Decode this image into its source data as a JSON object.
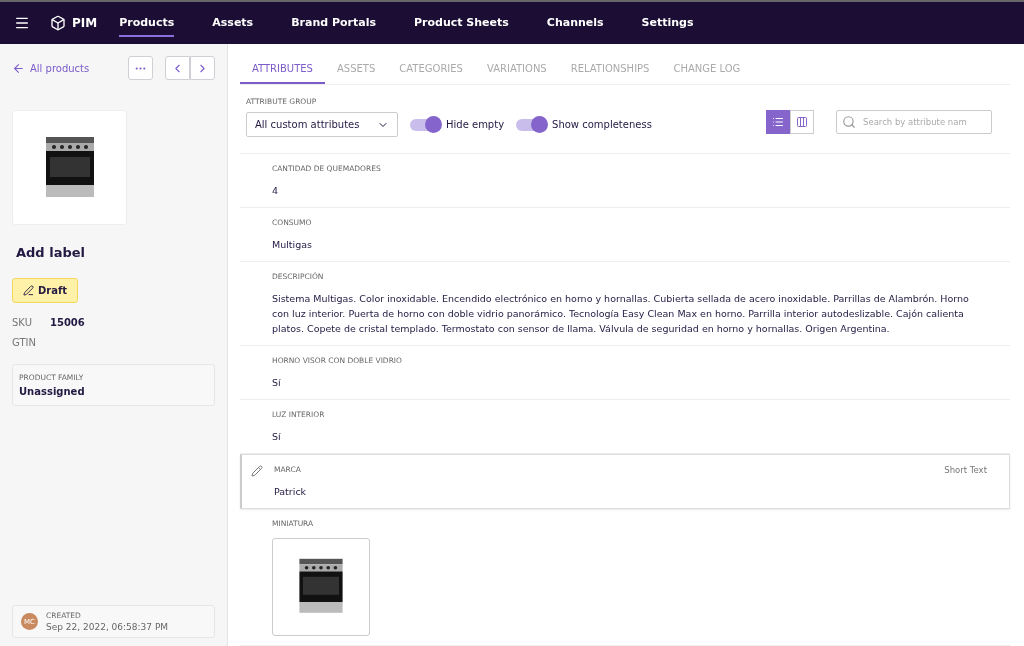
{
  "nav": {
    "brand": "PIM",
    "items": [
      {
        "label": "Products",
        "selected": true
      },
      {
        "label": "Assets",
        "selected": false
      },
      {
        "label": "Brand Portals",
        "selected": false
      },
      {
        "label": "Product Sheets",
        "selected": false
      },
      {
        "label": "Channels",
        "selected": false
      },
      {
        "label": "Settings",
        "selected": false
      }
    ]
  },
  "sidebar": {
    "back": "All products",
    "label": "Add label",
    "status": "Draft",
    "fields": [
      {
        "name": "SKU",
        "value": "15006"
      },
      {
        "name": "GTIN"
      }
    ],
    "family": {
      "title": "PRODUCT FAMILY",
      "value": "Unassigned"
    },
    "created": {
      "initials": "MC",
      "title": "CREATED",
      "value": "Sep 22, 2022, 06:58:37 PM"
    }
  },
  "tabs": [
    {
      "label": "ATTRIBUTES",
      "selected": true
    },
    {
      "label": "ASSETS",
      "selected": false
    },
    {
      "label": "CATEGORIES",
      "selected": false
    },
    {
      "label": "VARIATIONS",
      "selected": false
    },
    {
      "label": "RELATIONSHIPS",
      "selected": false
    },
    {
      "label": "CHANGE LOG",
      "selected": false
    }
  ],
  "toolbar": {
    "group_label": "ATTRIBUTE GROUP",
    "group_value": "All custom attributes",
    "toggles": [
      {
        "label": "Hide empty",
        "on": true
      },
      {
        "label": "Show completeness",
        "on": true
      }
    ],
    "views": [
      {
        "kind": "list",
        "selected": true
      },
      {
        "kind": "columns",
        "selected": false
      }
    ],
    "search": {
      "placeholder": "Search by attribute nam"
    }
  },
  "attributes": [
    {
      "kind": "text",
      "label": "CANTIDAD DE QUEMADORES",
      "value": "4",
      "highlighted": false
    },
    {
      "kind": "text",
      "label": "CONSUMO",
      "value": "Multigas",
      "highlighted": false
    },
    {
      "kind": "text",
      "label": "DESCRIPCIÓN",
      "value": "Sistema Multigas. Color inoxidable. Encendido electrónico en horno y hornallas. Cubierta sellada de acero inoxidable. Parrillas de Alambrón. Horno con luz interior. Puerta de horno con doble vidrio panorámico. Tecnología Easy Clean Max en horno. Parrilla interior autodeslizable. Cajón calienta platos. Copete de cristal templado. Termostato con sensor de llama. Válvula de seguridad en horno y hornallas. Origen Argentina.",
      "highlighted": false
    },
    {
      "kind": "text",
      "label": "HORNO VISOR CON DOBLE VIDRIO",
      "value": "Sí",
      "highlighted": false
    },
    {
      "kind": "text",
      "label": "LUZ INTERIOR",
      "value": "Sí",
      "highlighted": false
    },
    {
      "kind": "text",
      "label": "MARCA",
      "value": "Patrick",
      "highlighted": true,
      "type_label": "Short Text"
    },
    {
      "kind": "image",
      "label": "MINIATURA",
      "highlighted": false
    }
  ]
}
